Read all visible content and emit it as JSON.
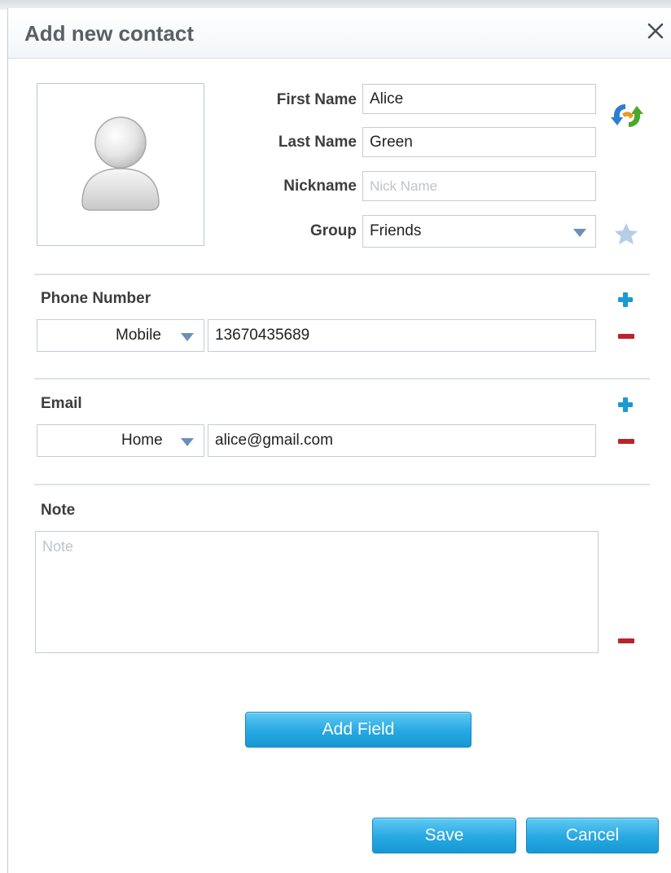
{
  "dialog": {
    "title": "Add new contact",
    "close_icon": "close-icon"
  },
  "avatar": {
    "icon": "user-silhouette-icon"
  },
  "name_fields": {
    "first_name": {
      "label": "First Name",
      "value": "Alice"
    },
    "last_name": {
      "label": "Last Name",
      "value": "Green"
    },
    "nickname": {
      "label": "Nickname",
      "value": "",
      "placeholder": "Nick Name"
    },
    "group": {
      "label": "Group",
      "value": "Friends"
    },
    "swap_icon": "swap-names-icon",
    "favorite_icon": "star-icon"
  },
  "phone": {
    "title": "Phone Number",
    "type": "Mobile",
    "value": "13670435689"
  },
  "email": {
    "title": "Email",
    "type": "Home",
    "value": "alice@gmail.com"
  },
  "note": {
    "title": "Note",
    "placeholder": "Note",
    "value": ""
  },
  "buttons": {
    "add_field": "Add Field",
    "save": "Save",
    "cancel": "Cancel"
  },
  "colors": {
    "accent_blue": "#26a8e2",
    "remove_red": "#b8242a",
    "add_blue": "#1a9ad6"
  }
}
